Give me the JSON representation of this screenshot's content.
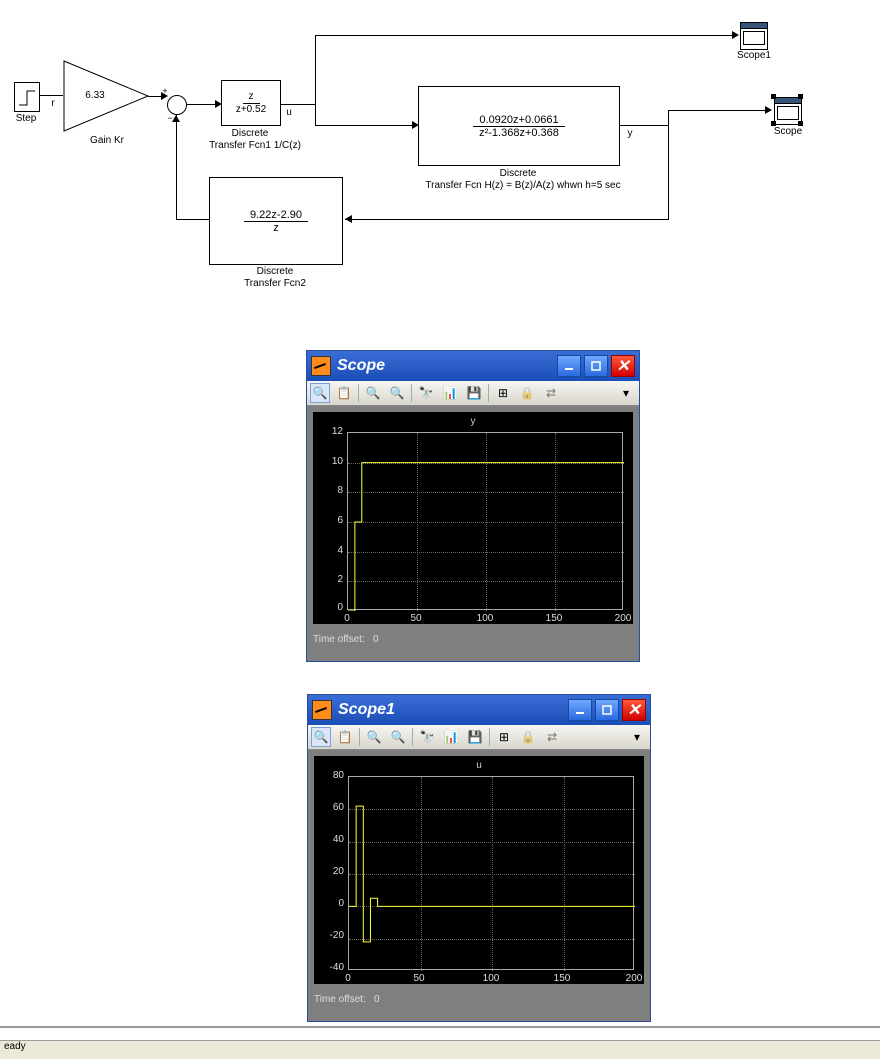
{
  "diagram": {
    "step_label": "Step",
    "step_sig": "r",
    "gain": {
      "value": "6.33",
      "label": "Gain Kr"
    },
    "tf1": {
      "num": "z",
      "den": "z+0.52",
      "label1": "Discrete",
      "label2": "Transfer Fcn1 1/C(z)",
      "sig": "u"
    },
    "tf_h": {
      "num": "0.0920z+0.0661",
      "den": "z²-1.368z+0.368",
      "label1": "Discrete",
      "label2": "Transfer Fcn H(z) = B(z)/A(z) whwn h=5 sec",
      "sig": "y"
    },
    "tf2": {
      "num": "9.22z-2.90",
      "den": "z",
      "label1": "Discrete",
      "label2": "Transfer Fcn2"
    },
    "scope1_label": "Scope1",
    "scope_label": "Scope"
  },
  "scopeA": {
    "title": "Scope",
    "plot_title": "y",
    "time_offset_label": "Time offset:",
    "time_offset_val": "0",
    "yticks": [
      "12",
      "10",
      "8",
      "6",
      "4",
      "2",
      "0"
    ],
    "xticks": [
      "0",
      "50",
      "100",
      "150",
      "200"
    ]
  },
  "scopeB": {
    "title": "Scope1",
    "plot_title": "u",
    "time_offset_label": "Time offset:",
    "time_offset_val": "0",
    "yticks": [
      "80",
      "60",
      "40",
      "20",
      "0",
      "-20",
      "-40"
    ],
    "xticks": [
      "0",
      "50",
      "100",
      "150",
      "200"
    ]
  },
  "status": "eady",
  "chart_data": [
    {
      "type": "line",
      "title": "y",
      "xlabel": "",
      "ylabel": "",
      "xlim": [
        0,
        200
      ],
      "ylim": [
        0,
        12
      ],
      "x": [
        0,
        5,
        10,
        15,
        200
      ],
      "y": [
        0,
        6,
        10,
        10,
        10
      ]
    },
    {
      "type": "line",
      "title": "u",
      "xlabel": "",
      "ylabel": "",
      "xlim": [
        0,
        200
      ],
      "ylim": [
        -40,
        80
      ],
      "x": [
        0,
        5,
        10,
        15,
        20,
        25,
        30,
        200
      ],
      "y": [
        0,
        62,
        -22,
        5,
        0,
        0,
        0,
        0
      ]
    }
  ],
  "toolbar_icons": [
    "print",
    "params",
    "zoom-in",
    "zoom-x",
    "zoom-y",
    "binoculars",
    "autoscale",
    "save-axes",
    "sync",
    "lock",
    "float"
  ],
  "colors": {
    "titlebar": "#2a6ae0",
    "close": "#d10000",
    "trace": "#ffff33",
    "plotbg": "#000000"
  }
}
